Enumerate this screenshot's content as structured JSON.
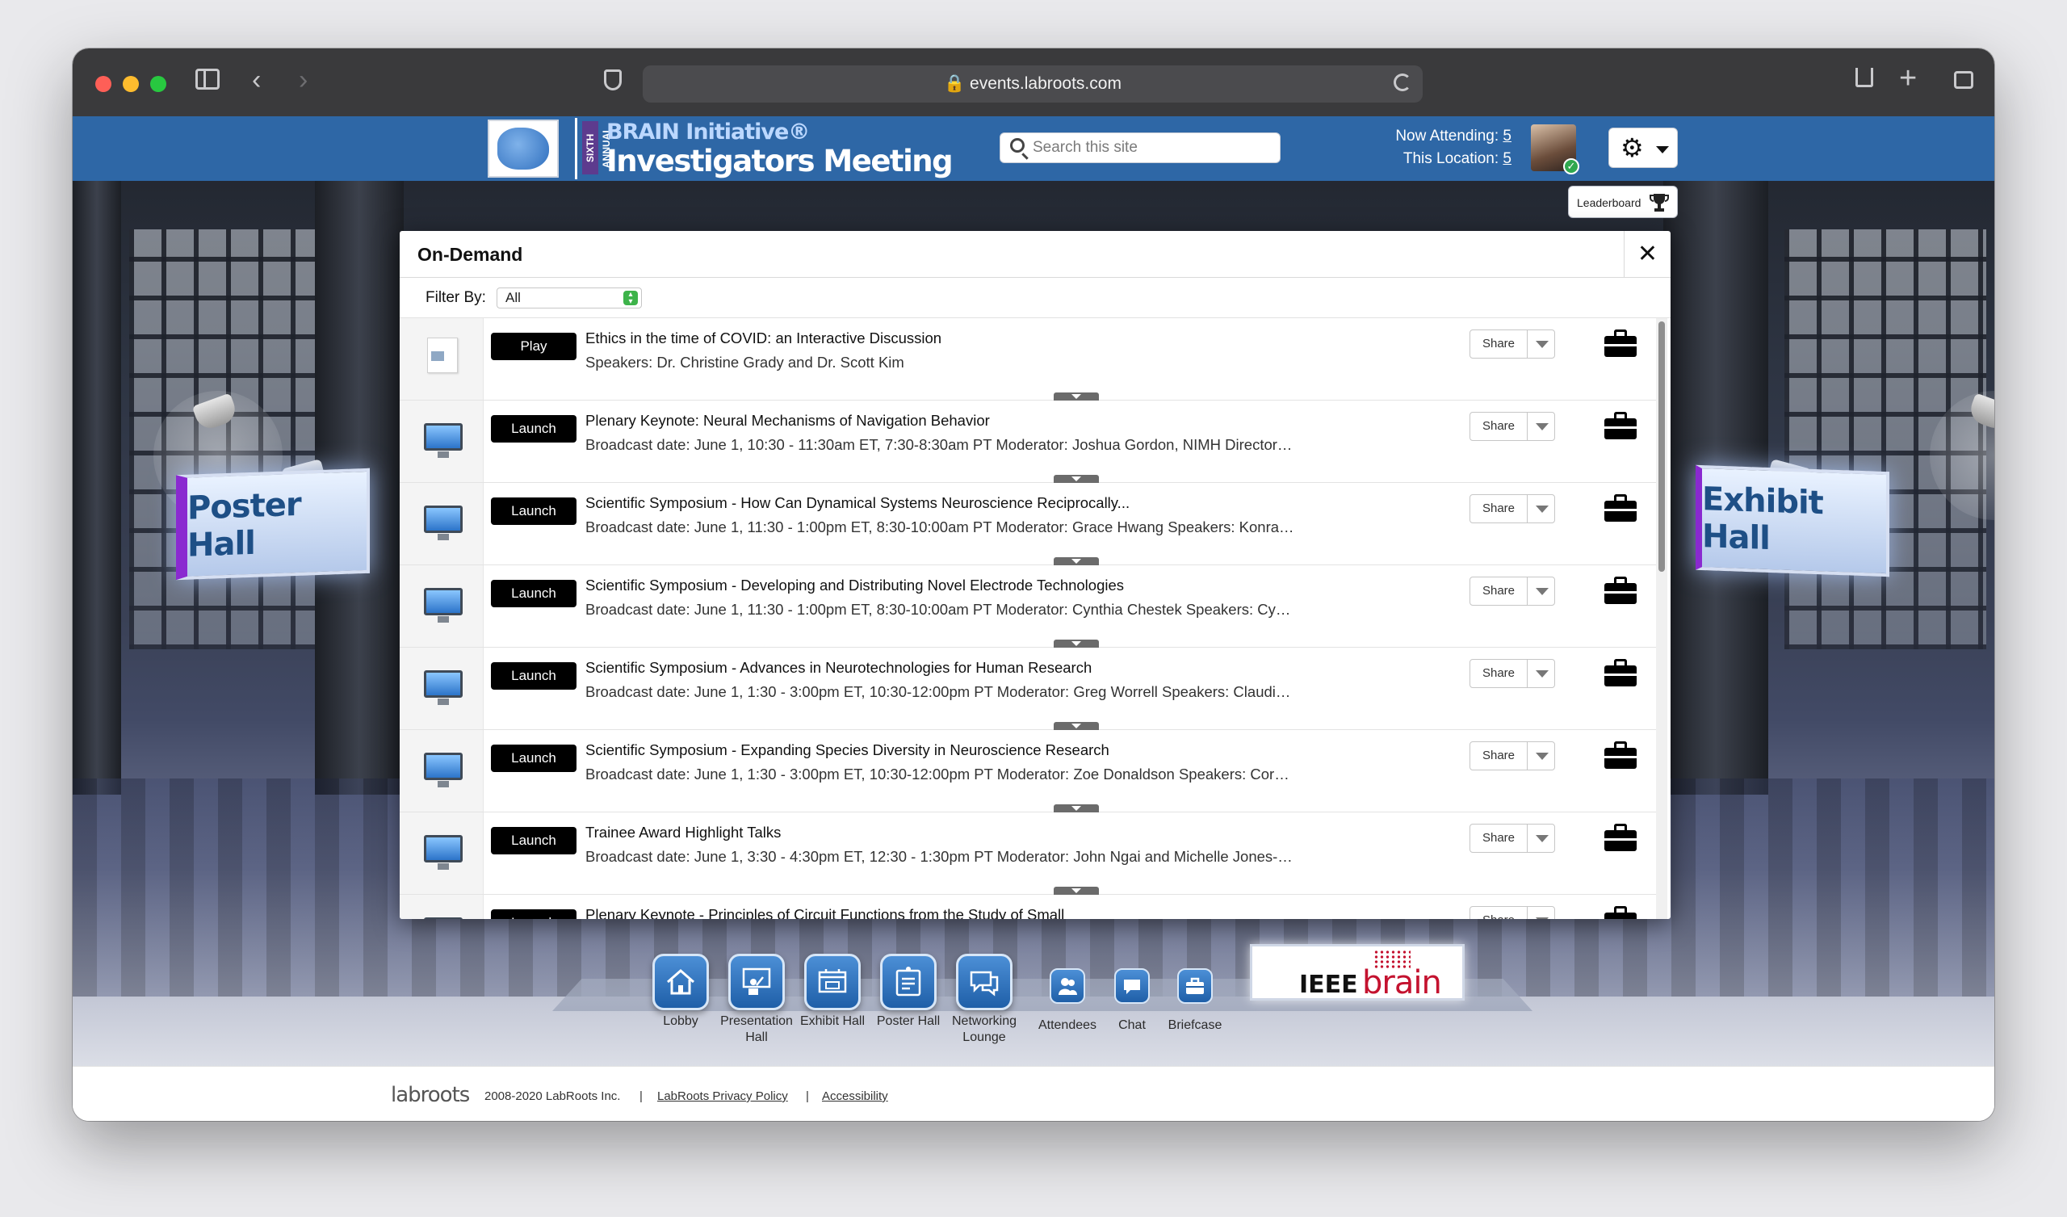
{
  "browser": {
    "url": "events.labroots.com"
  },
  "header": {
    "logo_line1": "BRAIN Initiative®",
    "logo_line2": "Investigators Meeting",
    "logo_badge": "SIXTH ANNUAL",
    "search_placeholder": "Search this site",
    "now_attending_label": "Now Attending:",
    "now_attending_value": "5",
    "this_location_label": "This Location:",
    "this_location_value": "5",
    "leaderboard_label": "Leaderboard"
  },
  "room": {
    "left_sign": "Poster Hall",
    "right_sign": "Exhibit Hall"
  },
  "modal": {
    "title": "On-Demand",
    "close_glyph": "✕",
    "filter_label": "Filter By:",
    "filter_value": "All",
    "share_label": "Share",
    "items": [
      {
        "icon": "document-icon",
        "button": "Play",
        "title": "Ethics in the time of COVID: an Interactive Discussion",
        "subtitle": "Speakers: Dr. Christine Grady and Dr. Scott Kim"
      },
      {
        "icon": "monitor-icon",
        "button": "Launch",
        "title": "Plenary Keynote: Neural Mechanisms of Navigation Behavior",
        "subtitle": "Broadcast date: June 1, 10:30 - 11:30am ET, 7:30-8:30am PT Moderator: Joshua Gordon, NIMH Director…"
      },
      {
        "icon": "monitor-icon",
        "button": "Launch",
        "title": "Scientific Symposium - How Can Dynamical Systems Neuroscience Reciprocally...",
        "subtitle": "Broadcast date: June 1, 11:30 - 1:00pm ET, 8:30-10:00am PT Moderator: Grace Hwang Speakers: Konra…"
      },
      {
        "icon": "monitor-icon",
        "button": "Launch",
        "title": "Scientific Symposium - Developing and Distributing Novel Electrode Technologies",
        "subtitle": "Broadcast date: June 1, 11:30 - 1:00pm ET, 8:30-10:00am PT Moderator: Cynthia Chestek Speakers: Cy…"
      },
      {
        "icon": "monitor-icon",
        "button": "Launch",
        "title": "Scientific Symposium - Advances in Neurotechnologies for Human Research",
        "subtitle": "Broadcast date: June 1, 1:30 - 3:00pm ET, 10:30-12:00pm PT Moderator: Greg Worrell Speakers: Claudi…"
      },
      {
        "icon": "monitor-icon",
        "button": "Launch",
        "title": "Scientific Symposium - Expanding Species Diversity in Neuroscience Research",
        "subtitle": "Broadcast date: June 1, 1:30 - 3:00pm ET, 10:30-12:00pm PT Moderator: Zoe Donaldson Speakers: Cor…"
      },
      {
        "icon": "monitor-icon",
        "button": "Launch",
        "title": "Trainee Award Highlight Talks",
        "subtitle": "Broadcast date: June 1, 3:30 - 4:30pm ET, 12:30 - 1:30pm PT Moderator: John Ngai and Michelle Jones-…"
      },
      {
        "icon": "monitor-icon",
        "button": "Launch",
        "title": "Plenary Keynote - Principles of Circuit Functions from the Study of Small",
        "subtitle": ""
      }
    ]
  },
  "nav": {
    "items": [
      {
        "label": "Lobby",
        "icon": "house-icon"
      },
      {
        "label": "Presentation Hall",
        "icon": "presenter-icon"
      },
      {
        "label": "Exhibit Hall",
        "icon": "booth-icon"
      },
      {
        "label": "Poster Hall",
        "icon": "poster-icon"
      },
      {
        "label": "Networking Lounge",
        "icon": "chat-bubbles-icon"
      },
      {
        "label": "Attendees",
        "icon": "people-icon"
      },
      {
        "label": "Chat",
        "icon": "chat-icon"
      },
      {
        "label": "Briefcase",
        "icon": "briefcase-icon"
      }
    ],
    "sponsor_prefix": "IEEE",
    "sponsor_word": "brain"
  },
  "footer": {
    "logo": "labroots",
    "copyright": "2008-2020 LabRoots Inc.",
    "separator": "|",
    "privacy": "LabRoots Privacy Policy",
    "accessibility": "Accessibility"
  },
  "colors": {
    "header_bg": "#2e67a6",
    "accent_green": "#3db34a",
    "sponsor_red": "#c4122f"
  }
}
